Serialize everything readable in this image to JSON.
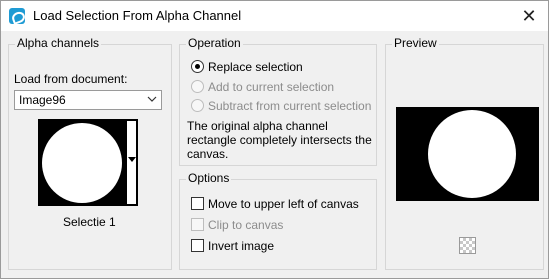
{
  "window": {
    "title": "Load Selection From Alpha Channel",
    "close_glyph": "✕",
    "app_icon": "paintshop-icon"
  },
  "alpha_channels": {
    "group_title": "Alpha channels",
    "load_from_label": "Load from document:",
    "document_selected": "Image96",
    "channel_name": "Selectie 1"
  },
  "operation": {
    "group_title": "Operation",
    "options": [
      {
        "label": "Replace selection",
        "selected": true,
        "enabled": true
      },
      {
        "label": "Add to current selection",
        "selected": false,
        "enabled": false
      },
      {
        "label": "Subtract from current selection",
        "selected": false,
        "enabled": false
      }
    ],
    "message_line1": "The original alpha channel",
    "message_line2": "rectangle completely intersects the",
    "message_line3": "canvas."
  },
  "options": {
    "group_title": "Options",
    "checkboxes": [
      {
        "label": "Move to upper left of canvas",
        "checked": false,
        "enabled": true
      },
      {
        "label": "Clip to canvas",
        "checked": false,
        "enabled": false
      },
      {
        "label": "Invert image",
        "checked": false,
        "enabled": true
      }
    ]
  },
  "preview": {
    "group_title": "Preview"
  },
  "colors": {
    "dialog_bg": "#f0f0f0",
    "disabled_text": "#8c8c8c",
    "accent_icon": "#1f9bd4"
  }
}
